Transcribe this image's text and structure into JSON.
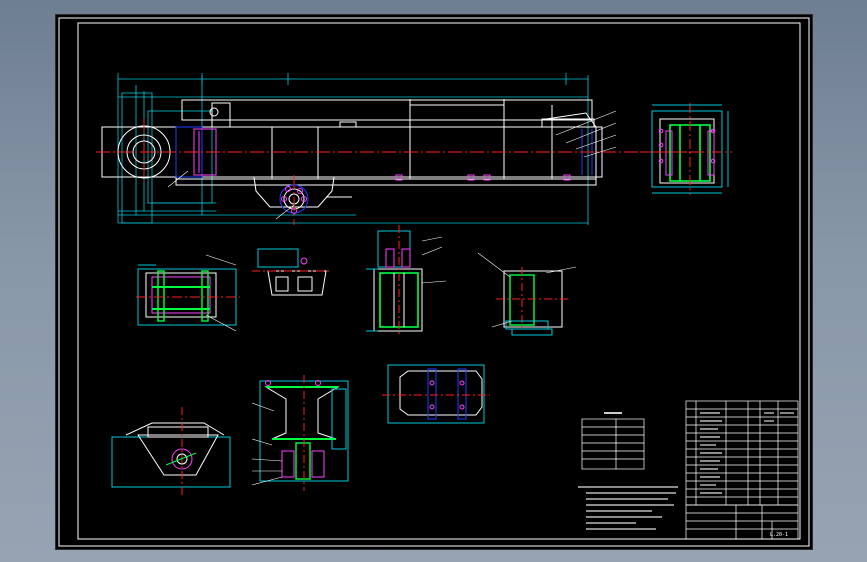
{
  "drawing": {
    "background": "#000000",
    "colors": {
      "outline": "#ffffff",
      "dimension": "#00c8d8",
      "centerline": "#ff2020",
      "hidden": "#2040ff",
      "section": "#00ff40",
      "part": "#ff40ff",
      "label": "#ffff00"
    },
    "sheet_no": "L.20-1"
  },
  "tables": {
    "bom_rows": 14,
    "spec_rows": 6
  }
}
